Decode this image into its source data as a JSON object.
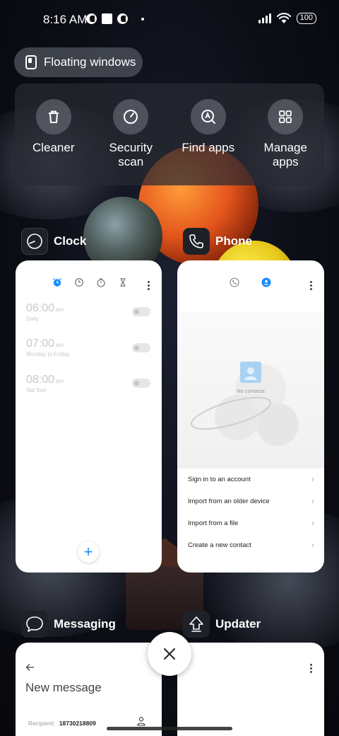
{
  "status_bar": {
    "time": "8:16 AM",
    "battery": "100",
    "icons": [
      "notification-icon-a",
      "notification-icon-b",
      "notification-icon-c",
      "wifi-icon",
      "signal-icon",
      "battery-icon"
    ]
  },
  "floating_windows": {
    "label": "Floating windows"
  },
  "tools": [
    {
      "label": "Cleaner",
      "icon": "trash-icon"
    },
    {
      "label": "Security\nscan",
      "icon": "speedometer-icon"
    },
    {
      "label": "Find apps",
      "icon": "search-apps-icon"
    },
    {
      "label": "Manage\napps",
      "icon": "grid-icon"
    }
  ],
  "apps": {
    "clock": {
      "name": "Clock",
      "alarms": [
        {
          "time": "06:00",
          "ampm": "am",
          "repeat": "Daily"
        },
        {
          "time": "07:00",
          "ampm": "am",
          "repeat": "Monday to Friday"
        },
        {
          "time": "08:00",
          "ampm": "am",
          "repeat": "Sat Sun"
        }
      ],
      "add_label": "+"
    },
    "phone": {
      "name": "Phone",
      "empty_text": "No contacts",
      "options": [
        "Sign in to an account",
        "Import from an older device",
        "Import from a file",
        "Create a new contact"
      ]
    },
    "messaging": {
      "name": "Messaging",
      "title": "New message",
      "recipient_label": "Recipient:",
      "recipient_value": "18730218809"
    },
    "updater": {
      "name": "Updater"
    }
  },
  "colors": {
    "accent": "#1a8cff",
    "panel": "#2a2c34",
    "card": "#ffffff"
  }
}
